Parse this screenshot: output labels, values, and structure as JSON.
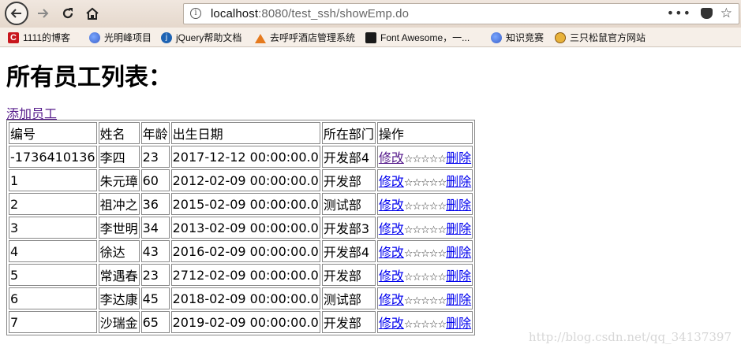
{
  "browser": {
    "url_host": "localhost",
    "url_path": ":8080/test_ssh/showEmp.do",
    "more_label": "•••"
  },
  "bookmarks": [
    {
      "label": "1111的博客",
      "icon": "csdn-icon"
    },
    {
      "label": "光明峰项目",
      "icon": "globe-icon"
    },
    {
      "label": "jQuery帮助文档",
      "icon": "jquery-icon"
    },
    {
      "label": "去呼呼酒店管理系统",
      "icon": "house-icon"
    },
    {
      "label": "Font Awesome，一...",
      "icon": "font-awesome-icon"
    },
    {
      "label": "知识竞赛",
      "icon": "globe-icon"
    },
    {
      "label": "三只松鼠官方网站",
      "icon": "squirrel-icon"
    }
  ],
  "page": {
    "title": "所有员工列表：",
    "add_link": "添加员工"
  },
  "table": {
    "headers": [
      "编号",
      "姓名",
      "年龄",
      "出生日期",
      "所在部门",
      "操作"
    ],
    "edit_label": "修改",
    "delete_label": "删除",
    "stars": "☆☆☆☆☆",
    "rows": [
      {
        "id": "-1736410136",
        "name": "李四",
        "age": "23",
        "birth": "2017-12-12 00:00:00.0",
        "dept": "开发部4"
      },
      {
        "id": "1",
        "name": "朱元璋",
        "age": "60",
        "birth": "2012-02-09 00:00:00.0",
        "dept": "开发部"
      },
      {
        "id": "2",
        "name": "祖冲之",
        "age": "36",
        "birth": "2015-02-09 00:00:00.0",
        "dept": "测试部"
      },
      {
        "id": "3",
        "name": "李世明",
        "age": "34",
        "birth": "2013-02-09 00:00:00.0",
        "dept": "开发部3"
      },
      {
        "id": "4",
        "name": "徐达",
        "age": "43",
        "birth": "2016-02-09 00:00:00.0",
        "dept": "开发部4"
      },
      {
        "id": "5",
        "name": "常遇春",
        "age": "23",
        "birth": "2712-02-09 00:00:00.0",
        "dept": "开发部"
      },
      {
        "id": "6",
        "name": "李达康",
        "age": "45",
        "birth": "2018-02-09 00:00:00.0",
        "dept": "测试部"
      },
      {
        "id": "7",
        "name": "沙瑞金",
        "age": "65",
        "birth": "2019-02-09 00:00:00.0",
        "dept": "开发部"
      }
    ]
  },
  "watermark": "http://blog.csdn.net/qq_34137397"
}
